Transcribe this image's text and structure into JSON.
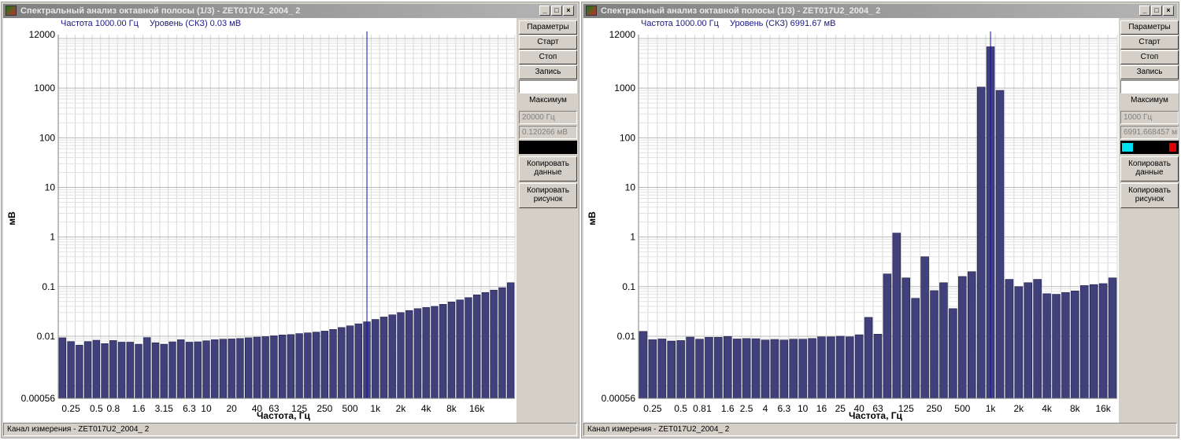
{
  "windows": [
    {
      "id": "a",
      "title": "Спектральный анализ октавной полосы (1/3) - ZET017U2_2004_ 2",
      "info_freq": "Частота 1000.00 Гц",
      "info_level": "Уровень (СКЗ)   0.03 мВ",
      "buttons": {
        "params": "Параметры",
        "start": "Старт",
        "stop": "Стоп",
        "record": "Запись",
        "copy_data": "Копировать данные",
        "copy_image": "Копировать рисунок"
      },
      "max_label": "Максимум",
      "max_freq": "20000 Гц",
      "max_value": "0.120266 мВ",
      "indicator_left_color": "#000000",
      "indicator_right_color": "#000000",
      "status": "Канал измерения - ZET017U2_2004_ 2"
    },
    {
      "id": "b",
      "title": "Спектральный анализ октавной полосы (1/3) - ZET017U2_2004_ 2",
      "info_freq": "Частота 1000.00 Гц",
      "info_level": "Уровень (СКЗ) 6991.67 мВ",
      "buttons": {
        "params": "Параметры",
        "start": "Старт",
        "stop": "Стоп",
        "record": "Запись",
        "copy_data": "Копировать данные",
        "copy_image": "Копировать рисунок"
      },
      "max_label": "Максимум",
      "max_freq": "1000 Гц",
      "max_value": "6991.668457 мВ",
      "indicator_left_color": "#00e0f0",
      "indicator_right_color": "#e00000",
      "status": "Канал измерения - ZET017U2_2004_ 2"
    }
  ],
  "chart_data": [
    {
      "type": "bar",
      "scale": "log",
      "ylabel": "мВ",
      "xlabel": "Частота, Гц",
      "ylim": [
        0.00056,
        12000
      ],
      "ytick_labels": [
        "12000",
        "1000",
        "100",
        "10",
        "1",
        "0.1",
        "0.01",
        "0.00056"
      ],
      "ytick_values": [
        12000,
        1000,
        100,
        10,
        1,
        0.1,
        0.01,
        0.00056
      ],
      "xtick_labels": [
        "0.25",
        "0.5",
        "0.8",
        "1.6",
        "3.15",
        "6.3",
        "10",
        "20",
        "40",
        "63",
        "125",
        "250",
        "500",
        "1k",
        "2k",
        "4k",
        "8k",
        "16k"
      ],
      "xtick_index": [
        1,
        4,
        6,
        9,
        12,
        15,
        17,
        20,
        23,
        25,
        28,
        31,
        34,
        37,
        40,
        43,
        46,
        49
      ],
      "cursor_index": 36,
      "bar_color": "#40407a",
      "values": [
        0.0093,
        0.0078,
        0.0066,
        0.0078,
        0.0083,
        0.0071,
        0.0082,
        0.0076,
        0.0076,
        0.0069,
        0.0094,
        0.0074,
        0.0069,
        0.0077,
        0.0085,
        0.0076,
        0.0077,
        0.0081,
        0.0085,
        0.0087,
        0.0088,
        0.009,
        0.0093,
        0.0096,
        0.0098,
        0.0102,
        0.0106,
        0.0108,
        0.0113,
        0.0117,
        0.0121,
        0.0127,
        0.0137,
        0.015,
        0.0162,
        0.0178,
        0.0195,
        0.0218,
        0.0244,
        0.027,
        0.03,
        0.033,
        0.036,
        0.038,
        0.04,
        0.044,
        0.049,
        0.054,
        0.06,
        0.068,
        0.076,
        0.085,
        0.095,
        0.12
      ]
    },
    {
      "type": "bar",
      "scale": "log",
      "ylabel": "мВ",
      "xlabel": "Частота, Гц",
      "ylim": [
        0.00056,
        12000
      ],
      "ytick_labels": [
        "12000",
        "1000",
        "100",
        "10",
        "1",
        "0.1",
        "0.01",
        "0.00056"
      ],
      "ytick_values": [
        12000,
        1000,
        100,
        10,
        1,
        0.1,
        0.01,
        0.00056
      ],
      "xtick_labels": [
        "0.25",
        "0.5",
        "0.8",
        "1",
        "1.6",
        "2.5",
        "4",
        "6.3",
        "10",
        "16",
        "25",
        "40",
        "63",
        "125",
        "250",
        "500",
        "1k",
        "2k",
        "4k",
        "8k",
        "16k"
      ],
      "xtick_index": [
        1,
        4,
        6,
        7,
        9,
        11,
        13,
        15,
        17,
        19,
        21,
        23,
        25,
        28,
        31,
        34,
        37,
        40,
        43,
        46,
        49
      ],
      "cursor_index": 37,
      "bar_color": "#40407a",
      "values": [
        0.0125,
        0.0085,
        0.0088,
        0.008,
        0.0082,
        0.0096,
        0.0087,
        0.0095,
        0.0095,
        0.0099,
        0.0088,
        0.009,
        0.0089,
        0.0084,
        0.0086,
        0.0084,
        0.0087,
        0.0087,
        0.009,
        0.0097,
        0.0097,
        0.01,
        0.0097,
        0.0107,
        0.024,
        0.011,
        0.18,
        1.2,
        0.15,
        0.058,
        0.4,
        0.083,
        0.12,
        0.036,
        0.16,
        0.2,
        1050,
        6800,
        900,
        0.14,
        0.1,
        0.12,
        0.14,
        0.072,
        0.07,
        0.076,
        0.082,
        0.105,
        0.11,
        0.115,
        0.15
      ]
    }
  ]
}
